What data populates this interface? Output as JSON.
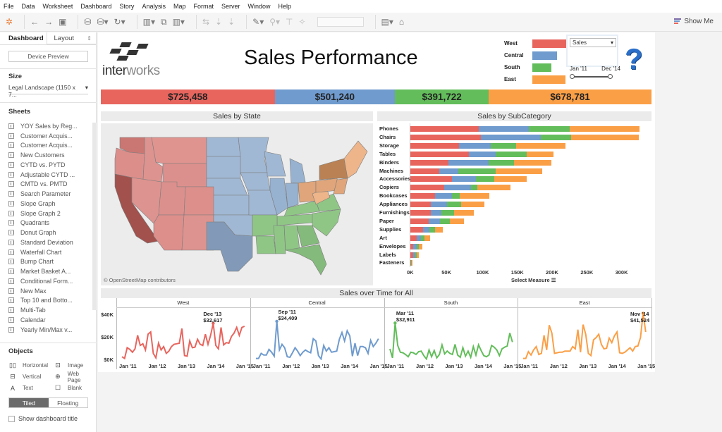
{
  "menu": [
    "File",
    "Data",
    "Worksheet",
    "Dashboard",
    "Story",
    "Analysis",
    "Map",
    "Format",
    "Server",
    "Window",
    "Help"
  ],
  "toolbar": {
    "icons": [
      "tableau-logo-icon",
      "back-icon",
      "forward-icon",
      "save-icon",
      "new-datasource-icon",
      "pause-datasource-icon",
      "refresh-icon",
      "new-worksheet-icon",
      "duplicate-sheet-icon",
      "clear-sheet-icon",
      "swap-icon",
      "sort-ascending-icon",
      "sort-descending-icon",
      "highlight-icon",
      "group-icon",
      "label-icon",
      "pin-icon",
      "show-cards-icon",
      "presentation-icon"
    ],
    "show_me": "Show Me"
  },
  "sidebar": {
    "tab_dashboard": "Dashboard",
    "tab_layout": "Layout",
    "tab_layout_arrow": "⇕",
    "device_preview": "Device Preview",
    "size_title": "Size",
    "size_value": "Legal Landscape (1150 x 7...",
    "sheets_title": "Sheets",
    "sheets": [
      "YOY Sales by Reg...",
      "Customer Acquis...",
      "Customer Acquis...",
      "New Customers",
      "CYTD vs. PYTD",
      "Adjustable CYTD ...",
      "CMTD vs. PMTD",
      "Search Parameter",
      "Slope Graph",
      "Slope Graph 2",
      "Quadrants",
      "Donut Graph",
      "Standard Deviation",
      "Waterfall Chart",
      "Bump Chart",
      "Market Basket A...",
      "Conditional Form...",
      "New Max",
      "Top 10 and Botto...",
      "Multi-Tab",
      "Calendar",
      "Yearly Min/Max v..."
    ],
    "objects_title": "Objects",
    "objects": [
      {
        "icon": "▯▯",
        "label": "Horizontal",
        "name": "horizontal"
      },
      {
        "icon": "⊡",
        "label": "Image",
        "name": "image"
      },
      {
        "icon": "⊟",
        "label": "Vertical",
        "name": "vertical"
      },
      {
        "icon": "⊕",
        "label": "Web Page",
        "name": "web-page"
      },
      {
        "icon": "A",
        "label": "Text",
        "name": "text"
      },
      {
        "icon": "☐",
        "label": "Blank",
        "name": "blank"
      }
    ],
    "tiled": "Tiled",
    "floating": "Floating",
    "show_title": "Show dashboard title"
  },
  "dashboard": {
    "logo_a": "inter",
    "logo_b": "works",
    "title": "Sales Performance",
    "colors": {
      "West": "#e8655e",
      "Central": "#6f9bce",
      "South": "#63bd5b",
      "East": "#fb9f46"
    },
    "legend": [
      {
        "label": "West",
        "share": 1.0
      },
      {
        "label": "Central",
        "share": 0.69
      },
      {
        "label": "South",
        "share": 0.54
      },
      {
        "label": "East",
        "share": 0.94
      }
    ],
    "measure_select": "Sales",
    "date_start": "Jan '11",
    "date_end": "Dec '14",
    "kpis": [
      {
        "region": "West",
        "value": "$725,458",
        "amount": 725458
      },
      {
        "region": "Central",
        "value": "$501,240",
        "amount": 501240
      },
      {
        "region": "South",
        "value": "$391,722",
        "amount": 391722
      },
      {
        "region": "East",
        "value": "$678,781",
        "amount": 678781
      }
    ],
    "map_title": "Sales by State",
    "map_credit": "© OpenStreetMap contributors",
    "bar_title": "Sales by SubCategory",
    "select_measure": "Select Measure",
    "lines_title": "Sales over Time for All"
  },
  "chart_data": [
    {
      "type": "bar",
      "title": "Sales by SubCategory",
      "xlabel": "Select Measure",
      "xlim": [
        0,
        340000
      ],
      "xticks": [
        "0K",
        "50K",
        "100K",
        "150K",
        "200K",
        "250K",
        "300K"
      ],
      "categories": [
        "Phones",
        "Chairs",
        "Storage",
        "Tables",
        "Binders",
        "Machines",
        "Accessories",
        "Copiers",
        "Bookcases",
        "Appliances",
        "Furnishings",
        "Paper",
        "Supplies",
        "Art",
        "Envelopes",
        "Labels",
        "Fasteners"
      ],
      "series": [
        {
          "name": "West",
          "values": [
            98000,
            101500,
            70000,
            84000,
            55000,
            42000,
            60000,
            49000,
            36000,
            29000,
            29000,
            26000,
            18000,
            9000,
            4000,
            4000,
            1000
          ]
        },
        {
          "name": "Central",
          "values": [
            73000,
            86000,
            46000,
            39000,
            57500,
            27000,
            34000,
            38000,
            24000,
            24000,
            16000,
            17000,
            9000,
            6000,
            5000,
            3000,
            500
          ]
        },
        {
          "name": "South",
          "values": [
            58000,
            44000,
            36000,
            44000,
            37000,
            54000,
            27000,
            9000,
            11000,
            20000,
            18000,
            14000,
            9000,
            5000,
            3000,
            2000,
            500
          ]
        },
        {
          "name": "East",
          "values": [
            101000,
            97000,
            71000,
            39000,
            53000,
            67000,
            46000,
            48000,
            43000,
            34000,
            28000,
            20000,
            11000,
            8000,
            5000,
            3000,
            1000
          ]
        }
      ]
    },
    {
      "type": "line",
      "title": "Sales over Time for All",
      "ylim": [
        0,
        45000
      ],
      "yticks": [
        "$0K",
        "$20K",
        "$40K"
      ],
      "xticks": [
        "Jan '11",
        "Jan '12",
        "Jan '13",
        "Jan '14",
        "Jan '15"
      ],
      "series": [
        {
          "name": "West",
          "annotation": {
            "label": "Dec '13",
            "value": "$32,617",
            "index": 35
          },
          "values": [
            3000,
            1500,
            11000,
            9500,
            7000,
            10000,
            22000,
            13000,
            14500,
            9000,
            23000,
            25000,
            6000,
            2000,
            15000,
            9000,
            12000,
            6000,
            8000,
            12000,
            14000,
            14500,
            15000,
            28000,
            4000,
            3500,
            17000,
            11000,
            11500,
            18500,
            14000,
            13000,
            23000,
            14000,
            22000,
            32617,
            13000,
            10000,
            29000,
            13500,
            15500,
            15000,
            21000,
            24000,
            29000,
            22000,
            29000,
            30000
          ]
        },
        {
          "name": "Central",
          "annotation": {
            "label": "Sep '11",
            "value": "$34,409",
            "index": 8
          },
          "values": [
            1500,
            1500,
            6000,
            4500,
            4500,
            9500,
            7000,
            3500,
            34409,
            9000,
            14000,
            11000,
            3000,
            2500,
            6500,
            11000,
            8000,
            4000,
            7000,
            9000,
            7500,
            6500,
            19000,
            17000,
            4000,
            1000,
            13000,
            8000,
            11000,
            7000,
            7500,
            8000,
            18500,
            24500,
            17000,
            26000,
            21500,
            3500,
            15000,
            4000,
            12000,
            12000,
            11000,
            6000,
            17500,
            12000,
            15000,
            19000
          ]
        },
        {
          "name": "South",
          "annotation": {
            "label": "Mar '11",
            "value": "$32,911",
            "index": 2
          },
          "values": [
            10000,
            2000,
            32911,
            13000,
            7000,
            6500,
            5000,
            3000,
            7000,
            6500,
            5000,
            7500,
            8000,
            4000,
            1000,
            9000,
            3000,
            8500,
            2000,
            5000,
            13500,
            5500,
            8000,
            6000,
            5000,
            14000,
            4500,
            2500,
            11000,
            3500,
            8000,
            2500,
            12000,
            4500,
            13500,
            8500,
            4000,
            3000,
            4500,
            13000,
            11500,
            9000,
            4000,
            10000,
            11500,
            12500,
            24000,
            16000
          ]
        },
        {
          "name": "East",
          "annotation": {
            "label": "Nov '14",
            "value": "$41,524",
            "index": 46
          },
          "values": [
            1500,
            1500,
            7500,
            4500,
            9000,
            12000,
            5000,
            6000,
            22000,
            9000,
            31000,
            24000,
            6000,
            6500,
            7000,
            7000,
            8000,
            8000,
            8000,
            12000,
            10000,
            27000,
            7000,
            31500,
            23000,
            6000,
            4000,
            18000,
            20000,
            23000,
            14000,
            10000,
            10500,
            19500,
            15500,
            21500,
            25000,
            6500,
            6000,
            7000,
            9000,
            11000,
            8000,
            12000,
            12500,
            20000,
            41524,
            25000
          ]
        }
      ]
    }
  ]
}
